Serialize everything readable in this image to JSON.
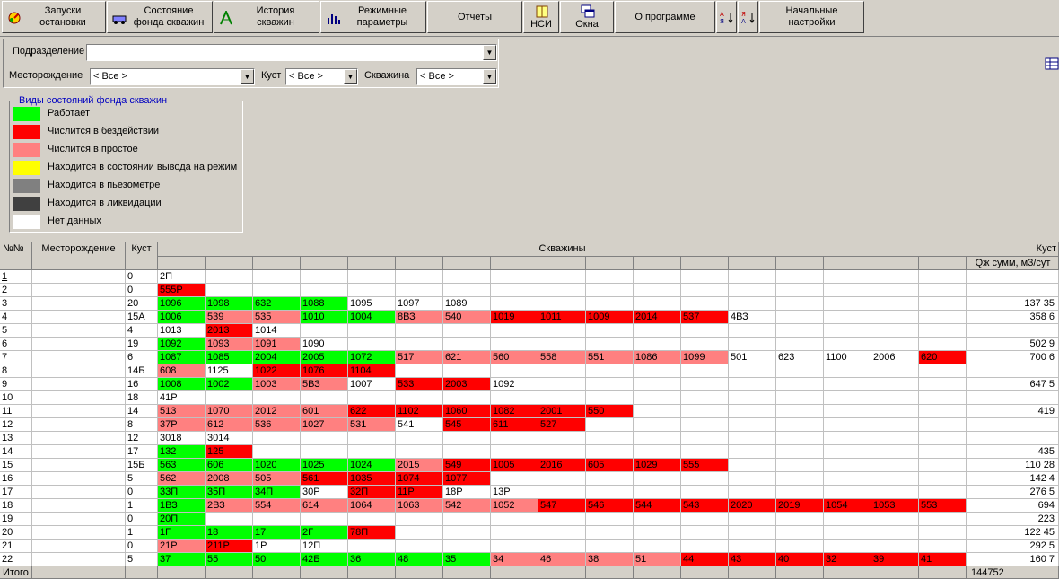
{
  "toolbar": {
    "buttons": [
      {
        "name": "starts-stops-button",
        "label": "Запуски\nостановки",
        "icon": "gauge-icon"
      },
      {
        "name": "well-fund-state-button",
        "label": "Состояние\nфонда скважин",
        "icon": "car-icon"
      },
      {
        "name": "history-button",
        "label": "История\nскважин",
        "icon": "well-rig-icon"
      },
      {
        "name": "mode-params-button",
        "label": "Режимные\nпараметры",
        "icon": "bar-chart-icon"
      },
      {
        "name": "reports-button",
        "label": "Отчеты",
        "icon": ""
      },
      {
        "name": "nsi-button",
        "label": "НСИ",
        "icon": "book-icon"
      },
      {
        "name": "windows-button",
        "label": "Окна",
        "icon": "windows-icon"
      },
      {
        "name": "about-button",
        "label": "О программе",
        "icon": ""
      },
      {
        "name": "sort-asc-button",
        "label": "",
        "icon": "sort-ascending-icon"
      },
      {
        "name": "sort-desc-button",
        "label": "",
        "icon": "sort-descending-icon"
      },
      {
        "name": "initial-settings-button",
        "label": "Начальные\nнастройки",
        "icon": ""
      }
    ]
  },
  "filters": {
    "subdivision_label": "Подразделение",
    "subdivision_value": "",
    "field_label": "Месторождение",
    "field_value": "< Все >",
    "cluster_label": "Куст",
    "cluster_value": "< Все >",
    "well_label": "Скважина",
    "well_value": "< Все >"
  },
  "legend": {
    "title": "Виды состояний фонда скважин",
    "items": [
      {
        "label": "Работает",
        "color": "#00ff00"
      },
      {
        "label": "Числится в бездействии",
        "color": "#ff0000"
      },
      {
        "label": "Числится в простое",
        "color": "#ff8080"
      },
      {
        "label": "Находится в состоянии вывода на режим",
        "color": "#ffff00"
      },
      {
        "label": "Находится в пьезометре",
        "color": "#808080"
      },
      {
        "label": "Находится в ликвидации",
        "color": "#404040"
      },
      {
        "label": "Нет данных",
        "color": "#ffffff"
      }
    ]
  },
  "status_colors": {
    "W": "#00ff00",
    "B": "#ff0000",
    "P": "#ff8080",
    "N": "#ffffff"
  },
  "grid": {
    "headers": {
      "num": "№№",
      "field": "Месторождение",
      "cluster": "Куст",
      "wells": "Скважины",
      "right_group": "Куст",
      "right_sub": "Qж сумм, м3/сут"
    },
    "rows": [
      {
        "num": "1",
        "cluster": "0",
        "q": "",
        "wells": [
          [
            "2П",
            "N"
          ]
        ]
      },
      {
        "num": "2",
        "cluster": "0",
        "q": "",
        "wells": [
          [
            "555Р",
            "B"
          ]
        ]
      },
      {
        "num": "3",
        "cluster": "20",
        "q": "137 35",
        "wells": [
          [
            "1096",
            "W"
          ],
          [
            "1098",
            "W"
          ],
          [
            "632",
            "W"
          ],
          [
            "1088",
            "W"
          ],
          [
            "1095",
            "N"
          ],
          [
            "1097",
            "N"
          ],
          [
            "1089",
            "N"
          ]
        ]
      },
      {
        "num": "4",
        "cluster": "15А",
        "q": "358 6",
        "wells": [
          [
            "1006",
            "W"
          ],
          [
            "539",
            "P"
          ],
          [
            "535",
            "P"
          ],
          [
            "1010",
            "W"
          ],
          [
            "1004",
            "W"
          ],
          [
            "8ВЗ",
            "P"
          ],
          [
            "540",
            "P"
          ],
          [
            "1019",
            "B"
          ],
          [
            "1011",
            "B"
          ],
          [
            "1009",
            "B"
          ],
          [
            "2014",
            "B"
          ],
          [
            "537",
            "B"
          ],
          [
            "4ВЗ",
            "N"
          ]
        ]
      },
      {
        "num": "5",
        "cluster": "4",
        "q": "",
        "wells": [
          [
            "1013",
            "N"
          ],
          [
            "2013",
            "B"
          ],
          [
            "1014",
            "N"
          ]
        ]
      },
      {
        "num": "6",
        "cluster": "19",
        "q": "502 9",
        "wells": [
          [
            "1092",
            "W"
          ],
          [
            "1093",
            "P"
          ],
          [
            "1091",
            "P"
          ],
          [
            "1090",
            "N"
          ]
        ]
      },
      {
        "num": "7",
        "cluster": "6",
        "q": "700 6",
        "wells": [
          [
            "1087",
            "W"
          ],
          [
            "1085",
            "W"
          ],
          [
            "2004",
            "W"
          ],
          [
            "2005",
            "W"
          ],
          [
            "1072",
            "W"
          ],
          [
            "517",
            "P"
          ],
          [
            "621",
            "P"
          ],
          [
            "560",
            "P"
          ],
          [
            "558",
            "P"
          ],
          [
            "551",
            "P"
          ],
          [
            "1086",
            "P"
          ],
          [
            "1099",
            "P"
          ],
          [
            "501",
            "N"
          ],
          [
            "623",
            "N"
          ],
          [
            "1100",
            "N"
          ],
          [
            "2006",
            "N"
          ],
          [
            "620",
            "B"
          ]
        ]
      },
      {
        "num": "8",
        "cluster": "14Б",
        "q": "",
        "wells": [
          [
            "608",
            "P"
          ],
          [
            "1125",
            "N"
          ],
          [
            "1022",
            "B"
          ],
          [
            "1076",
            "B"
          ],
          [
            "1104",
            "B"
          ]
        ]
      },
      {
        "num": "9",
        "cluster": "16",
        "q": "647 5",
        "wells": [
          [
            "1008",
            "W"
          ],
          [
            "1002",
            "W"
          ],
          [
            "1003",
            "P"
          ],
          [
            "5ВЗ",
            "P"
          ],
          [
            "1007",
            "N"
          ],
          [
            "533",
            "B"
          ],
          [
            "2003",
            "B"
          ],
          [
            "1092",
            "N"
          ]
        ]
      },
      {
        "num": "10",
        "cluster": "18",
        "q": "",
        "wells": [
          [
            "41Р",
            "N"
          ]
        ]
      },
      {
        "num": "11",
        "cluster": "14",
        "q": "419",
        "wells": [
          [
            "513",
            "P"
          ],
          [
            "1070",
            "P"
          ],
          [
            "2012",
            "P"
          ],
          [
            "601",
            "P"
          ],
          [
            "622",
            "B"
          ],
          [
            "1102",
            "B"
          ],
          [
            "1060",
            "B"
          ],
          [
            "1082",
            "B"
          ],
          [
            "2001",
            "B"
          ],
          [
            "550",
            "B"
          ]
        ]
      },
      {
        "num": "12",
        "cluster": "8",
        "q": "",
        "wells": [
          [
            "37Р",
            "P"
          ],
          [
            "612",
            "P"
          ],
          [
            "536",
            "P"
          ],
          [
            "1027",
            "P"
          ],
          [
            "531",
            "P"
          ],
          [
            "541",
            "N"
          ],
          [
            "545",
            "B"
          ],
          [
            "611",
            "B"
          ],
          [
            "527",
            "B"
          ]
        ]
      },
      {
        "num": "13",
        "cluster": "12",
        "q": "",
        "wells": [
          [
            "3018",
            "N"
          ],
          [
            "3014",
            "N"
          ]
        ]
      },
      {
        "num": "14",
        "cluster": "17",
        "q": "435",
        "wells": [
          [
            "132",
            "W"
          ],
          [
            "125",
            "B"
          ]
        ]
      },
      {
        "num": "15",
        "cluster": "15Б",
        "q": "110 28",
        "wells": [
          [
            "563",
            "W"
          ],
          [
            "606",
            "W"
          ],
          [
            "1020",
            "W"
          ],
          [
            "1025",
            "W"
          ],
          [
            "1024",
            "W"
          ],
          [
            "2015",
            "P"
          ],
          [
            "549",
            "B"
          ],
          [
            "1005",
            "B"
          ],
          [
            "2016",
            "B"
          ],
          [
            "605",
            "B"
          ],
          [
            "1029",
            "B"
          ],
          [
            "555",
            "B"
          ]
        ]
      },
      {
        "num": "16",
        "cluster": "5",
        "q": "142 4",
        "wells": [
          [
            "562",
            "P"
          ],
          [
            "2008",
            "P"
          ],
          [
            "505",
            "P"
          ],
          [
            "561",
            "B"
          ],
          [
            "1035",
            "B"
          ],
          [
            "1074",
            "B"
          ],
          [
            "1077",
            "B"
          ]
        ]
      },
      {
        "num": "17",
        "cluster": "0",
        "q": "276 5",
        "wells": [
          [
            "33П",
            "W"
          ],
          [
            "35П",
            "W"
          ],
          [
            "34П",
            "W"
          ],
          [
            "30Р",
            "N"
          ],
          [
            "32П",
            "B"
          ],
          [
            "11Р",
            "B"
          ],
          [
            "18Р",
            "N"
          ],
          [
            "13Р",
            "N"
          ]
        ]
      },
      {
        "num": "18",
        "cluster": "1",
        "q": "694",
        "wells": [
          [
            "1ВЗ",
            "W"
          ],
          [
            "2ВЗ",
            "P"
          ],
          [
            "554",
            "P"
          ],
          [
            "614",
            "P"
          ],
          [
            "1064",
            "P"
          ],
          [
            "1063",
            "P"
          ],
          [
            "542",
            "P"
          ],
          [
            "1052",
            "P"
          ],
          [
            "547",
            "B"
          ],
          [
            "546",
            "B"
          ],
          [
            "544",
            "B"
          ],
          [
            "543",
            "B"
          ],
          [
            "2020",
            "B"
          ],
          [
            "2019",
            "B"
          ],
          [
            "1054",
            "B"
          ],
          [
            "1053",
            "B"
          ],
          [
            "553",
            "B"
          ]
        ]
      },
      {
        "num": "19",
        "cluster": "0",
        "q": "223",
        "wells": [
          [
            "20П",
            "W"
          ]
        ]
      },
      {
        "num": "20",
        "cluster": "1",
        "q": "122 45",
        "wells": [
          [
            "1Г",
            "W"
          ],
          [
            "18",
            "W"
          ],
          [
            "17",
            "W"
          ],
          [
            "2Г",
            "W"
          ],
          [
            "78П",
            "B"
          ]
        ]
      },
      {
        "num": "21",
        "cluster": "0",
        "q": "292 5",
        "wells": [
          [
            "21Р",
            "P"
          ],
          [
            "211Р",
            "B"
          ],
          [
            "1Р",
            "N"
          ],
          [
            "12П",
            "N"
          ]
        ]
      },
      {
        "num": "22",
        "cluster": "5",
        "q": "160 7",
        "wells": [
          [
            "37",
            "W"
          ],
          [
            "55",
            "W"
          ],
          [
            "50",
            "W"
          ],
          [
            "42Б",
            "W"
          ],
          [
            "36",
            "W"
          ],
          [
            "48",
            "W"
          ],
          [
            "35",
            "W"
          ],
          [
            "34",
            "P"
          ],
          [
            "46",
            "P"
          ],
          [
            "38",
            "P"
          ],
          [
            "51",
            "P"
          ],
          [
            "44",
            "B"
          ],
          [
            "43",
            "B"
          ],
          [
            "40",
            "B"
          ],
          [
            "32",
            "B"
          ],
          [
            "39",
            "B"
          ],
          [
            "41",
            "B"
          ]
        ]
      }
    ],
    "footer": {
      "label": "Итого",
      "total": "144752"
    }
  }
}
